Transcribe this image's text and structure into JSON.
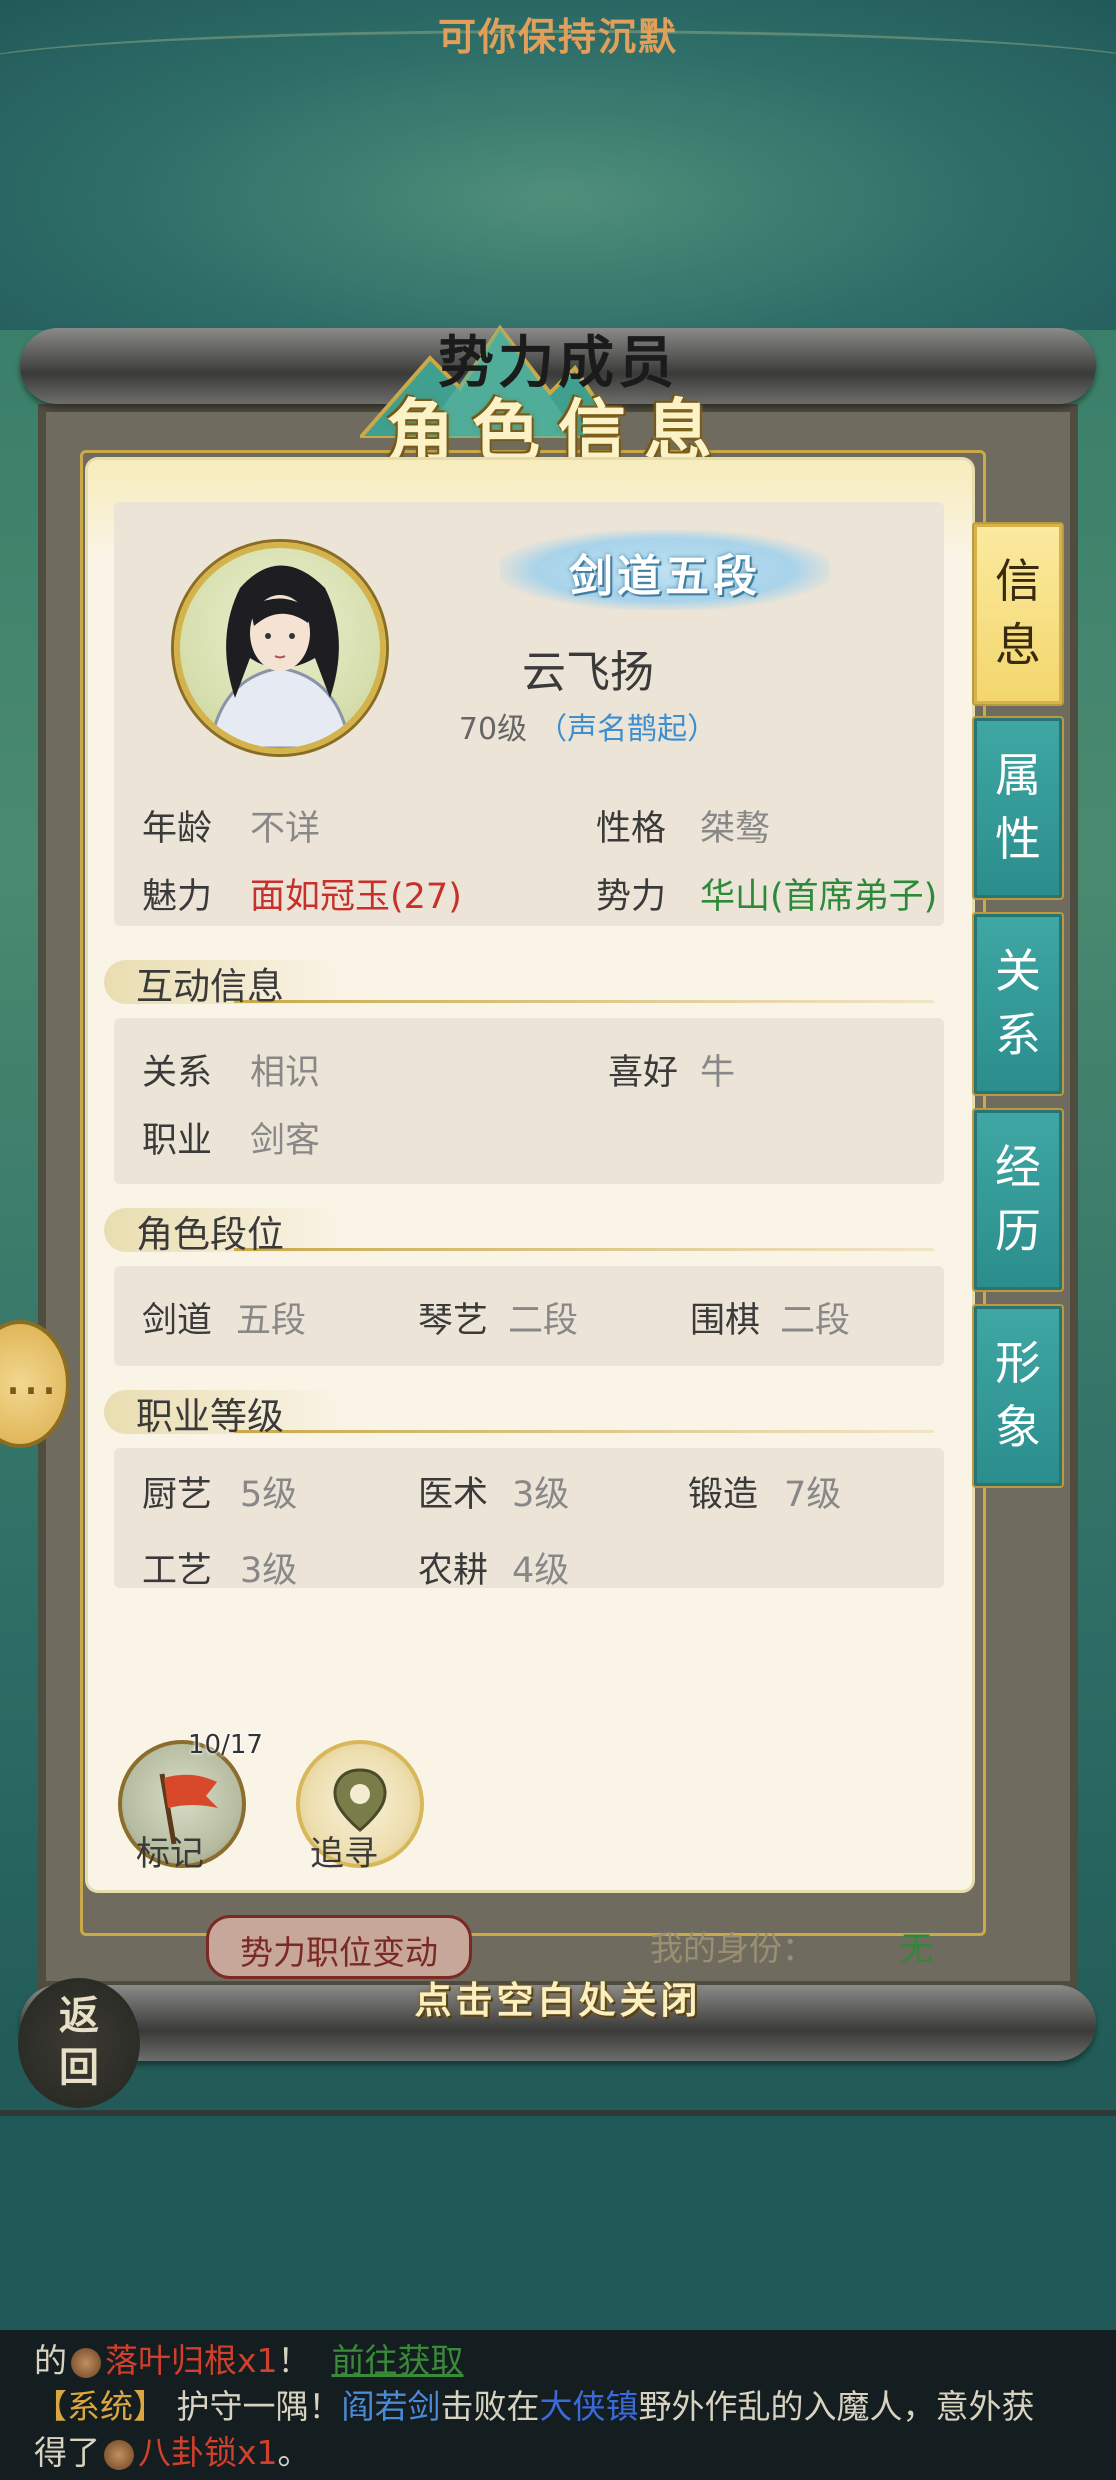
{
  "top_title": "可你保持沉默",
  "header": {
    "outline_title": "势力成员",
    "title": "角色信息"
  },
  "character": {
    "rank_badge": "剑道五段",
    "name": "云飞扬",
    "level": "70级",
    "fame": "（声名鹊起）"
  },
  "basic_info": {
    "age_label": "年龄",
    "age_value": "不详",
    "personality_label": "性格",
    "personality_value": "桀骜",
    "charm_label": "魅力",
    "charm_value": "面如冠玉(27)",
    "faction_label": "势力",
    "faction_value": "华山(首席弟子)"
  },
  "interaction": {
    "title": "互动信息",
    "relation_label": "关系",
    "relation_value": "相识",
    "hobby_label": "喜好",
    "hobby_value": "牛",
    "job_label": "职业",
    "job_value": "剑客"
  },
  "ranks": {
    "title": "角色段位",
    "items": [
      {
        "label": "剑道",
        "value": "五段"
      },
      {
        "label": "琴艺",
        "value": "二段"
      },
      {
        "label": "围棋",
        "value": "二段"
      }
    ]
  },
  "job_levels": {
    "title": "职业等级",
    "items": [
      {
        "label": "厨艺",
        "value": "5级"
      },
      {
        "label": "医术",
        "value": "3级"
      },
      {
        "label": "锻造",
        "value": "7级"
      },
      {
        "label": "工艺",
        "value": "3级"
      },
      {
        "label": "农耕",
        "value": "4级"
      }
    ]
  },
  "tabs": [
    {
      "label_1": "信",
      "label_2": "息",
      "active": true
    },
    {
      "label_1": "属",
      "label_2": "性",
      "active": false
    },
    {
      "label_1": "关",
      "label_2": "系",
      "active": false
    },
    {
      "label_1": "经",
      "label_2": "历",
      "active": false
    },
    {
      "label_1": "形",
      "label_2": "象",
      "active": false
    }
  ],
  "actions": {
    "mark_label": "标记",
    "mark_count": "10/17",
    "chase_label": "追寻",
    "faction_button": "势力职位变动",
    "identity_label": "我的身份：",
    "identity_value": "无",
    "close_tip": "点击空白处关闭",
    "back_label_1": "返",
    "back_label_2": "回"
  },
  "chat": {
    "line1_prefix": "的",
    "line1_item": "落叶归根x1",
    "line1_bang": "！",
    "line1_link": "前往获取",
    "line2_tag": "【系统】",
    "line2_text1": "护守一隅！",
    "line2_name": "阎若剑",
    "line2_text2": "击败在",
    "line2_place": "大侠镇",
    "line2_text3": "野外作乱的入魔人，意外获",
    "line3_prefix": "得了",
    "line3_item": "八卦锁x1",
    "line3_end": "。"
  },
  "colors": {
    "accent_gold": "#c9a94a",
    "tab_teal": "#3fa7a4",
    "charm_red": "#c8302c",
    "faction_green": "#2e8a3a",
    "fame_blue": "#3d8fd0"
  }
}
